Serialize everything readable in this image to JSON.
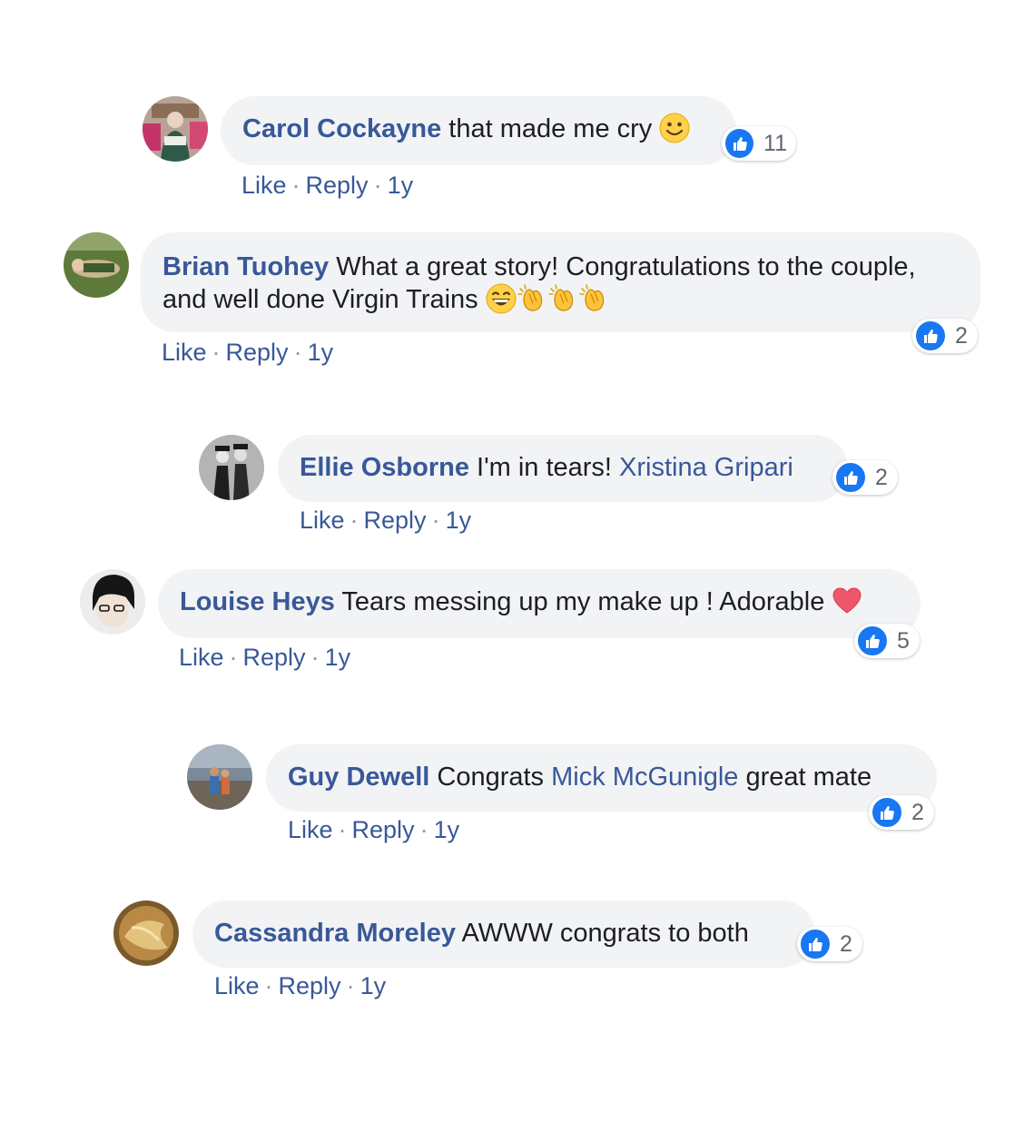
{
  "comments": [
    {
      "author": "Carol Cockayne",
      "text": "that made me cry",
      "emoji": [
        "smile-emoji"
      ],
      "reaction_count": "11",
      "actions": {
        "like": "Like",
        "reply": "Reply",
        "time": "1y"
      }
    },
    {
      "author": "Brian Tuohey",
      "text": "What a great story! Congratulations to the couple, and well done Virgin Trains",
      "emoji": [
        "grin-emoji",
        "clap-emoji",
        "clap-emoji",
        "clap-emoji"
      ],
      "reaction_count": "2",
      "actions": {
        "like": "Like",
        "reply": "Reply",
        "time": "1y"
      }
    },
    {
      "author": "Ellie Osborne",
      "text": "I'm in tears!",
      "mention": "Xristina Gripari",
      "reaction_count": "2",
      "actions": {
        "like": "Like",
        "reply": "Reply",
        "time": "1y"
      }
    },
    {
      "author": "Louise Heys",
      "text": "Tears messing up my make up ! Adorable",
      "emoji": [
        "heart-emoji"
      ],
      "reaction_count": "5",
      "actions": {
        "like": "Like",
        "reply": "Reply",
        "time": "1y"
      }
    },
    {
      "author": "Guy Dewell",
      "text": "Congrats",
      "mention": "Mick McGunigle",
      "text_after": "great mate",
      "reaction_count": "2",
      "actions": {
        "like": "Like",
        "reply": "Reply",
        "time": "1y"
      }
    },
    {
      "author": "Cassandra Moreley",
      "text": "AWWW congrats to both",
      "reaction_count": "2",
      "actions": {
        "like": "Like",
        "reply": "Reply",
        "time": "1y"
      }
    }
  ],
  "colors": {
    "link": "#385898",
    "bubble": "#f2f3f5",
    "like_blue": "#1877f2",
    "meta_grey": "#90949c"
  }
}
